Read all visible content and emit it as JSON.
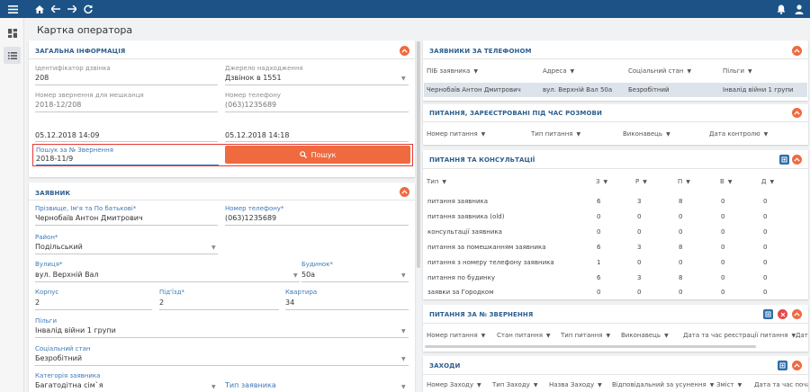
{
  "page": {
    "title": "Картка оператора"
  },
  "general": {
    "title": "ЗАГАЛЬНА ІНФОРМАЦІЯ",
    "call_id_label": "Ідентифікатор дзвінка",
    "call_id_value": "208",
    "source_label": "Джерело надходження",
    "source_value": "Дзвінок в 1551",
    "appeal_num_label": "Номер звернення для мешканця",
    "appeal_num_value": "2018-12/208",
    "phone_label": "Номер телефону",
    "phone_value": "(063)1235689",
    "start_time": "05.12.2018 14:09",
    "end_time": "05.12.2018 14:18",
    "search_label": "Пошук за № Звернення",
    "search_value": "2018-11/9",
    "search_button": "Пошук"
  },
  "applicant": {
    "title": "ЗАЯВНИК",
    "name_label": "Прізвище, Ім'я та По батькові*",
    "name_value": "Чернобаїв Антон Дмитрович",
    "phone_label": "Номер телефону*",
    "phone_value": "(063)1235689",
    "district_label": "Район*",
    "district_value": "Подільський",
    "street_label": "Вулиця*",
    "street_value": "вул. Верхній Вал",
    "building_label": "Будинок*",
    "building_value": "50а",
    "korpus_label": "Корпус",
    "korpus_value": "2",
    "entrance_label": "Під'їзд*",
    "entrance_value": "2",
    "apt_label": "Квартира",
    "apt_value": "34",
    "benefits_label": "Пільги",
    "benefits_value": "Інвалід війни 1 групи",
    "social_label": "Соціальний стан",
    "social_value": "Безробітний",
    "category_label": "Категорія заявника",
    "category_value": "Багатодітна сім`я",
    "type_label": "Тип заявника"
  },
  "by_phone": {
    "title": "ЗАЯВНИКИ ЗА ТЕЛЕФОНОМ",
    "columns": [
      "ПІБ заявника",
      "Адреса",
      "Соціальний стан",
      "Пільги"
    ],
    "row": [
      "Чернобаїв Антон Дмитрович",
      "вул. Верхній Вал 50а",
      "Безробітний",
      "Інвалід війни 1 групи"
    ]
  },
  "call_questions": {
    "title": "ПИТАННЯ, ЗАРЕЄСТРОВАНІ ПІД ЧАС РОЗМОВИ",
    "columns": [
      "Номер питання",
      "Тип питання",
      "Виконавець",
      "Дата контролю"
    ]
  },
  "consultations": {
    "title": "ПИТАННЯ ТА КОНСУЛЬТАЦІЇ",
    "columns": [
      "Тип",
      "З",
      "Р",
      "П",
      "В",
      "Д"
    ],
    "rows": [
      [
        "питання заявника",
        "6",
        "3",
        "8",
        "0",
        "0"
      ],
      [
        "питання заявника (old)",
        "0",
        "0",
        "0",
        "0",
        "0"
      ],
      [
        "консультації заявника",
        "0",
        "0",
        "0",
        "0",
        "0"
      ],
      [
        "питання за помешканням заявника",
        "6",
        "3",
        "8",
        "0",
        "0"
      ],
      [
        "питання з номеру телефону заявника",
        "1",
        "0",
        "0",
        "0",
        "0"
      ],
      [
        "питання по будинку",
        "6",
        "3",
        "8",
        "0",
        "0"
      ],
      [
        "заявки за Городком",
        "0",
        "0",
        "0",
        "0",
        "0"
      ]
    ]
  },
  "by_appeal": {
    "title": "ПИТАННЯ ЗА № ЗВЕРНЕННЯ",
    "columns": [
      "Номер питання",
      "Стан питання",
      "Тип питання",
      "Виконавець",
      "Дата та час реєстрації питання",
      "Дат"
    ]
  },
  "events": {
    "title": "ЗАХОДИ",
    "columns": [
      "Номер Заходу",
      "Тип Заходу",
      "Назва Заходу",
      "Відповідальний за усунення",
      "Зміст",
      "Дата та час поча"
    ]
  },
  "colors": {
    "topbar": "#1c5286",
    "accent": "#ef6a3f",
    "title": "#2d5e8e",
    "highlight": "#e53935"
  },
  "icons": [
    "menu-icon",
    "home-icon",
    "back-arrow-icon",
    "forward-arrow-icon",
    "refresh-icon",
    "bell-icon",
    "user-icon",
    "dashboard-icon",
    "list-icon",
    "search-icon",
    "chevron-up-icon",
    "close-icon",
    "filter-icon",
    "add-icon"
  ]
}
